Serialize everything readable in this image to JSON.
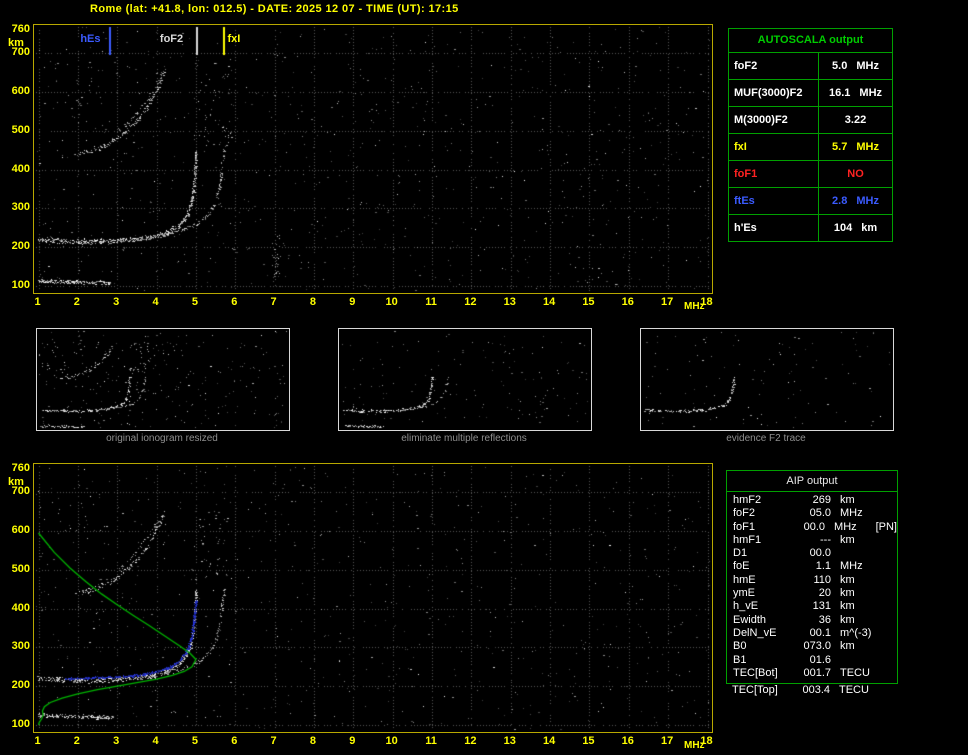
{
  "title": "Rome (lat: +41.8, lon: 012.5) - DATE: 2025 12 07 - TIME (UT): 17:15",
  "colors": {
    "accent_yellow": "#ffff00",
    "accent_green": "#00b400",
    "plot_border": "#b8a800",
    "table_border": "#00a000",
    "text_white": "#ffffff",
    "marker_blue": "#3b5bff",
    "alert_red": "#ff2222",
    "grid_gray": "#555555",
    "caption_gray": "#8f8f8f"
  },
  "autoscala_table": {
    "title": "AUTOSCALA output",
    "rows": [
      {
        "param": "foF2",
        "value": "5.0",
        "unit": "MHz",
        "color": "#ffffff"
      },
      {
        "param": "MUF(3000)F2",
        "value": "16.1",
        "unit": "MHz",
        "color": "#ffffff"
      },
      {
        "param": "M(3000)F2",
        "value": "3.22",
        "unit": "",
        "color": "#ffffff"
      },
      {
        "param": "fxI",
        "value": "5.7",
        "unit": "MHz",
        "color": "#ffff00"
      },
      {
        "param": "foF1",
        "value": "NO",
        "unit": "",
        "color": "#ff2222"
      },
      {
        "param": "ftEs",
        "value": "2.8",
        "unit": "MHz",
        "color": "#3b5bff"
      },
      {
        "param": "h'Es",
        "value": "104",
        "unit": "km",
        "color": "#ffffff"
      }
    ]
  },
  "panels": [
    {
      "caption": "original ionogram resized",
      "series": [
        "Es-layer",
        "F2-trace-o",
        "F2-trace-x",
        "F2-second-hop-o",
        "F2-second-hop-x",
        "spread-F-scatter",
        "upper-left-scatter"
      ],
      "noise": 260
    },
    {
      "caption": "eliminate multiple reflections",
      "series": [
        "Es-layer",
        "F2-trace-o",
        "F2-trace-x"
      ],
      "noise": 150
    },
    {
      "caption": "evidence F2 trace",
      "series": [
        "F2-trace-o"
      ],
      "noise": 110
    }
  ],
  "aip_table": {
    "title": "AIP output",
    "rows": [
      {
        "param": "hmF2",
        "value": "269",
        "unit": "km",
        "note": ""
      },
      {
        "param": "foF2",
        "value": "05.0",
        "unit": "MHz",
        "note": ""
      },
      {
        "param": "foF1",
        "value": "00.0",
        "unit": "MHz",
        "note": "[PN]"
      },
      {
        "param": "hmF1",
        "value": "---",
        "unit": "km",
        "note": ""
      },
      {
        "param": "D1",
        "value": "00.0",
        "unit": "",
        "note": ""
      },
      {
        "param": "foE",
        "value": "1.1",
        "unit": "MHz",
        "note": ""
      },
      {
        "param": "hmE",
        "value": "110",
        "unit": "km",
        "note": ""
      },
      {
        "param": "ymE",
        "value": "20",
        "unit": "km",
        "note": ""
      },
      {
        "param": "h_vE",
        "value": "131",
        "unit": "km",
        "note": ""
      },
      {
        "param": "Ewidth",
        "value": "36",
        "unit": "km",
        "note": ""
      },
      {
        "param": "DelN_vE",
        "value": "00.1",
        "unit": "m^(-3)",
        "note": ""
      },
      {
        "param": "B0",
        "value": "073.0",
        "unit": "km",
        "note": ""
      },
      {
        "param": "B1",
        "value": "01.6",
        "unit": "",
        "note": ""
      },
      {
        "param": "TEC[Bot]",
        "value": "001.7",
        "unit": "TECU",
        "note": ""
      }
    ],
    "tec_rows": [
      {
        "param": "TEC[Top]",
        "value": "003.4",
        "unit": "TECU",
        "note": ""
      }
    ]
  },
  "chart_data": [
    {
      "id": "main_ionogram",
      "type": "scatter",
      "title": "recorded ionogram (virtual height vs frequency)",
      "xlabel": "MHz",
      "ylabel": "km",
      "xlim": [
        1,
        18
      ],
      "ylim": [
        100,
        760
      ],
      "x_ticks": [
        1,
        2,
        3,
        4,
        5,
        6,
        7,
        8,
        9,
        10,
        11,
        12,
        13,
        14,
        15,
        16,
        17,
        18
      ],
      "y_ticks": [
        760,
        700,
        600,
        500,
        400,
        300,
        200,
        100
      ],
      "grid": true,
      "noise_dots": 780,
      "markers": [
        {
          "label": "hEs",
          "f": 2.8,
          "color": "#3b5bff"
        },
        {
          "label": "foF2",
          "f": 5.0,
          "color": "#d8d8d8"
        },
        {
          "label": "fxI",
          "f": 5.7,
          "color": "#ffff00"
        }
      ],
      "series": [
        {
          "name": "Es-layer",
          "color": "#ffffff",
          "density": 2.0,
          "jitter": 2.5,
          "points": [
            [
              1.0,
              112
            ],
            [
              1.8,
              110
            ],
            [
              2.9,
              107
            ]
          ]
        },
        {
          "name": "F2-trace-o",
          "color": "#ffffff",
          "density": 2.2,
          "jitter": 3,
          "points": [
            [
              1.0,
              220
            ],
            [
              1.6,
              216
            ],
            [
              2.2,
              214
            ],
            [
              2.8,
              215
            ],
            [
              3.4,
              219
            ],
            [
              3.9,
              227
            ],
            [
              4.3,
              239
            ],
            [
              4.6,
              257
            ],
            [
              4.8,
              284
            ],
            [
              4.9,
              318
            ],
            [
              4.97,
              372
            ],
            [
              5.01,
              445
            ]
          ]
        },
        {
          "name": "F2-trace-x",
          "color": "#d8d8d8",
          "density": 0.9,
          "jitter": 2.5,
          "points": [
            [
              3.5,
              221
            ],
            [
              4.1,
              229
            ],
            [
              4.6,
              241
            ],
            [
              5.0,
              257
            ],
            [
              5.3,
              281
            ],
            [
              5.5,
              314
            ],
            [
              5.62,
              364
            ],
            [
              5.68,
              418
            ],
            [
              5.72,
              452
            ]
          ]
        },
        {
          "name": "F2-second-hop-o",
          "color": "#e8e8e8",
          "density": 1.1,
          "jitter": 3,
          "points": [
            [
              1.9,
              438
            ],
            [
              2.3,
              447
            ],
            [
              2.7,
              461
            ],
            [
              3.1,
              487
            ],
            [
              3.5,
              524
            ],
            [
              3.8,
              564
            ],
            [
              4.05,
              614
            ],
            [
              4.2,
              652
            ]
          ]
        },
        {
          "name": "F2-second-hop-x",
          "color": "#c8c8c8",
          "density": 0.55,
          "jitter": 3,
          "points": [
            [
              3.0,
              498
            ],
            [
              3.4,
              534
            ],
            [
              3.8,
              583
            ],
            [
              4.05,
              628
            ],
            [
              4.2,
              662
            ]
          ]
        },
        {
          "name": "spread-F-scatter",
          "type": "blob",
          "color": "#d0d0d0",
          "f": [
            4.95,
            5.9
          ],
          "km": [
            455,
            675
          ],
          "n": 55
        },
        {
          "name": "upper-left-scatter",
          "type": "blob",
          "color": "#b0b0b0",
          "f": [
            1.0,
            3.0
          ],
          "km": [
            500,
            690
          ],
          "n": 30
        },
        {
          "name": "noise-streak",
          "type": "blob",
          "color": "#c0c0c0",
          "f": [
            6.9,
            7.15
          ],
          "km": [
            105,
            235
          ],
          "n": 28
        }
      ]
    },
    {
      "id": "profile_ionogram",
      "type": "scatter",
      "title": "ionogram with AUTOSCALA restored trace and electron density profile",
      "xlabel": "MHz",
      "ylabel": "km",
      "xlim": [
        1,
        18
      ],
      "ylim": [
        100,
        760
      ],
      "x_ticks": [
        1,
        2,
        3,
        4,
        5,
        6,
        7,
        8,
        9,
        10,
        11,
        12,
        13,
        14,
        15,
        16,
        17,
        18
      ],
      "y_ticks": [
        760,
        700,
        600,
        500,
        400,
        300,
        200,
        100
      ],
      "grid": true,
      "noise_dots": 640,
      "series": [
        {
          "name": "Es-layer",
          "color": "#ffffff",
          "density": 2.0,
          "jitter": 2.5,
          "points": [
            [
              1.0,
              125
            ],
            [
              1.8,
              122
            ],
            [
              2.9,
              118
            ]
          ]
        },
        {
          "name": "F2-trace-o",
          "color": "#ffffff",
          "density": 1.8,
          "jitter": 3,
          "points": [
            [
              1.0,
              220
            ],
            [
              1.6,
              216
            ],
            [
              2.2,
              214
            ],
            [
              2.8,
              215
            ],
            [
              3.4,
              219
            ],
            [
              3.9,
              227
            ],
            [
              4.3,
              239
            ],
            [
              4.6,
              257
            ],
            [
              4.8,
              284
            ],
            [
              4.9,
              318
            ],
            [
              4.97,
              372
            ],
            [
              5.01,
              445
            ]
          ]
        },
        {
          "name": "F2-trace-x",
          "color": "#d8d8d8",
          "density": 0.8,
          "jitter": 2.5,
          "points": [
            [
              3.5,
              221
            ],
            [
              4.1,
              229
            ],
            [
              4.6,
              241
            ],
            [
              5.0,
              257
            ],
            [
              5.3,
              281
            ],
            [
              5.5,
              314
            ],
            [
              5.62,
              364
            ],
            [
              5.68,
              418
            ],
            [
              5.72,
              452
            ]
          ]
        },
        {
          "name": "F2-second-hop-o",
          "color": "#e8e8e8",
          "density": 0.9,
          "jitter": 3,
          "points": [
            [
              1.9,
              438
            ],
            [
              2.3,
              447
            ],
            [
              2.7,
              461
            ],
            [
              3.1,
              487
            ],
            [
              3.5,
              524
            ],
            [
              3.8,
              564
            ],
            [
              4.05,
              614
            ],
            [
              4.2,
              652
            ]
          ]
        },
        {
          "name": "F2-second-hop-x",
          "color": "#c8c8c8",
          "density": 0.5,
          "jitter": 3,
          "points": [
            [
              3.0,
              498
            ],
            [
              3.4,
              534
            ],
            [
              3.8,
              583
            ],
            [
              4.05,
              628
            ]
          ]
        },
        {
          "name": "spread-F-scatter",
          "type": "blob",
          "color": "#c8c8c8",
          "f": [
            4.95,
            5.8
          ],
          "km": [
            455,
            660
          ],
          "n": 40
        },
        {
          "name": "upper-left-scatter",
          "type": "blob",
          "color": "#b0b0b0",
          "f": [
            1.0,
            3.0
          ],
          "km": [
            500,
            690
          ],
          "n": 25
        },
        {
          "name": "autoscala-trace",
          "color": "#2b3bee",
          "density": 3.2,
          "jitter": 1.3,
          "points": [
            [
              1.7,
              218
            ],
            [
              2.3,
              221
            ],
            [
              2.9,
              223
            ],
            [
              3.5,
              227
            ],
            [
              4.0,
              236
            ],
            [
              4.35,
              248
            ],
            [
              4.6,
              266
            ],
            [
              4.8,
              294
            ],
            [
              4.9,
              327
            ],
            [
              4.97,
              378
            ],
            [
              5.0,
              420
            ]
          ]
        },
        {
          "name": "electron-density-profile",
          "type": "line",
          "color": "#00b400",
          "points": [
            [
              1.0,
              595
            ],
            [
              1.4,
              545
            ],
            [
              1.8,
              505
            ],
            [
              2.2,
              470
            ],
            [
              2.6,
              438
            ],
            [
              3.0,
              410
            ],
            [
              3.4,
              383
            ],
            [
              3.8,
              357
            ],
            [
              4.2,
              330
            ],
            [
              4.6,
              303
            ],
            [
              4.85,
              285
            ],
            [
              5.0,
              269
            ],
            [
              4.9,
              250
            ],
            [
              4.7,
              238
            ],
            [
              4.4,
              228
            ],
            [
              4.0,
              218
            ],
            [
              3.5,
              209
            ],
            [
              3.0,
              200
            ],
            [
              2.5,
              191
            ],
            [
              2.0,
              180
            ],
            [
              1.6,
              169
            ],
            [
              1.3,
              158
            ],
            [
              1.15,
              147
            ],
            [
              1.1,
              136
            ],
            [
              1.12,
              126
            ],
            [
              1.08,
              116
            ],
            [
              1.02,
              107
            ],
            [
              1.0,
              100
            ]
          ]
        }
      ]
    }
  ]
}
